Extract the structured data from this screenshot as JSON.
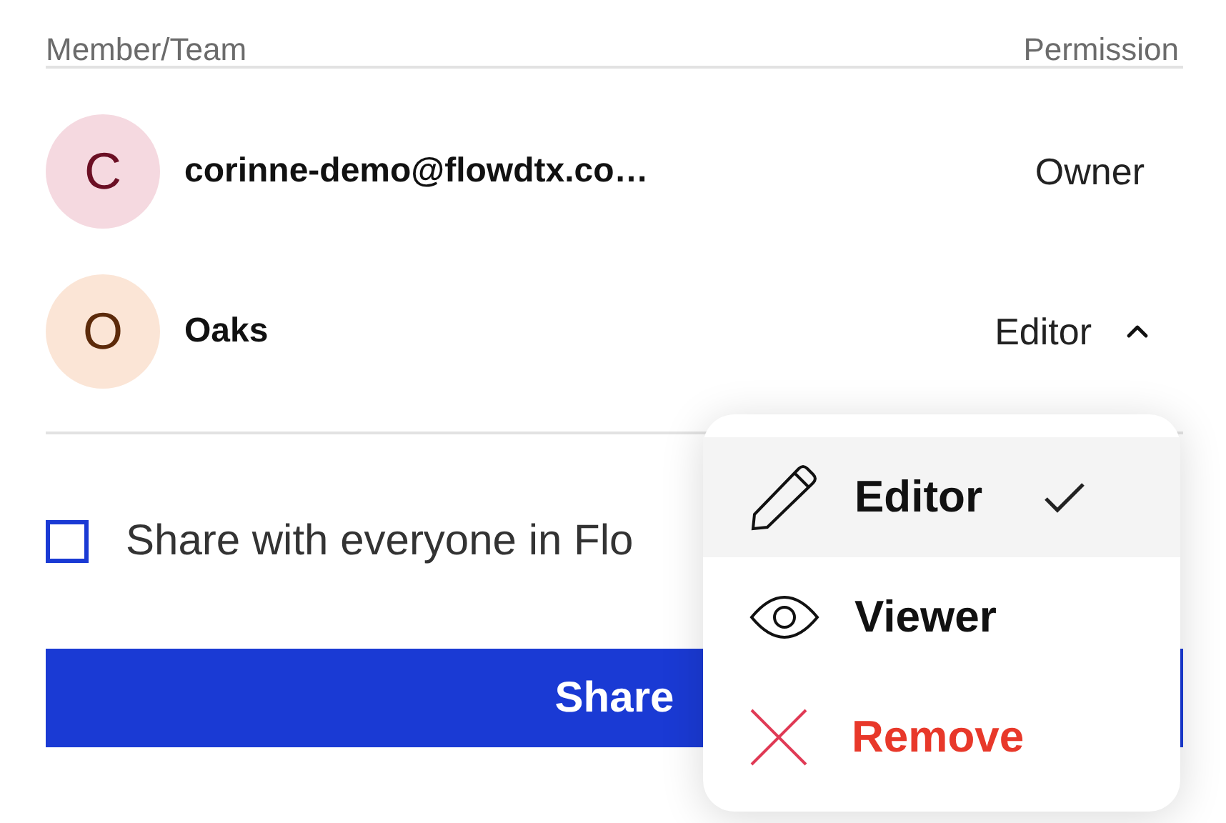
{
  "header": {
    "member_label": "Member/Team",
    "permission_label": "Permission"
  },
  "members": [
    {
      "initial": "C",
      "color": "#f5d9e0",
      "name": "corinne-demo@flowdtx.co…",
      "permission": "Owner",
      "kind": "fixed"
    },
    {
      "initial": "O",
      "color": "#fbe5d6",
      "name": "Oaks",
      "permission": "Editor",
      "kind": "dropdown",
      "expanded": true
    }
  ],
  "share_everyone": {
    "label": "Share with everyone in Flo",
    "checked": false
  },
  "share_button": "Share",
  "permission_menu": [
    {
      "kind": "editor",
      "label": "Editor",
      "selected": true
    },
    {
      "kind": "viewer",
      "label": "Viewer",
      "selected": false
    },
    {
      "kind": "remove",
      "label": "Remove",
      "selected": false
    }
  ]
}
